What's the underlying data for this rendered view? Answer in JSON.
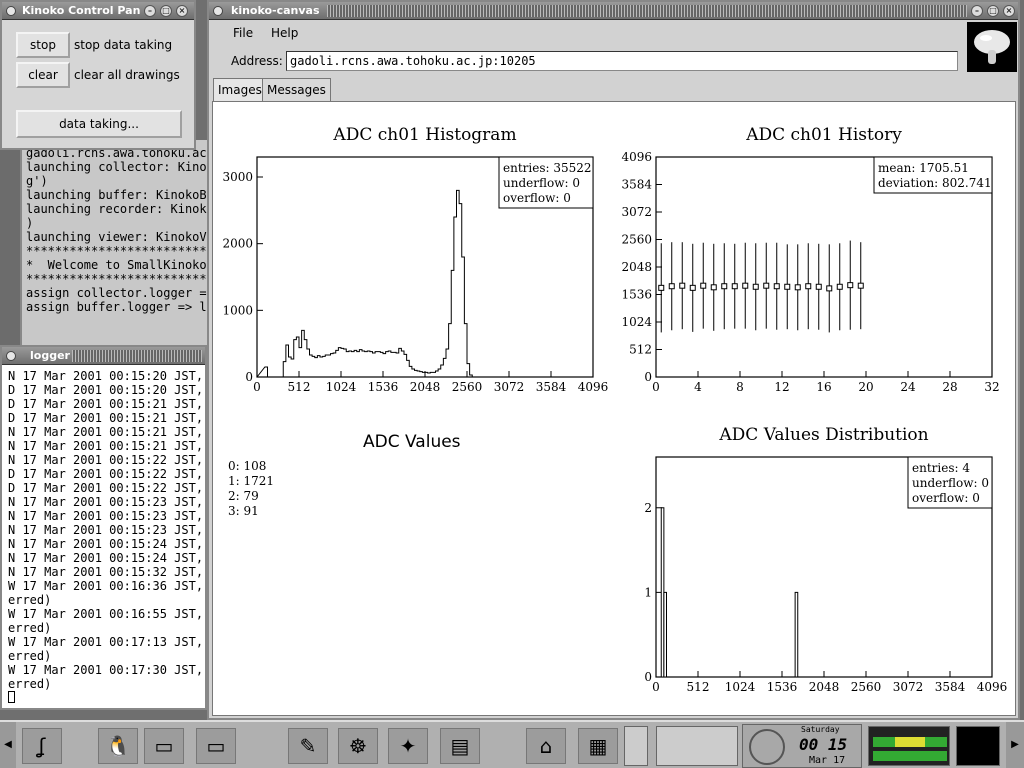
{
  "control_panel": {
    "title": "Kinoko Control Pan",
    "buttons": [
      {
        "label": "stop",
        "desc": "stop data taking"
      },
      {
        "label": "clear",
        "desc": "clear all drawings"
      }
    ],
    "data_taking_label": "data taking..."
  },
  "console": {
    "lines": [
      "gadoli.rcns.awa.tohoku.ac",
      "launching collector: Kinok",
      "g')",
      "launching buffer: KinokoBu",
      "launching recorder: Kinoko",
      ")",
      "launching viewer: KinokoVi",
      "",
      "**************************",
      "*  Welcome to SmallKinoko",
      "**************************",
      "",
      "assign collector.logger =>",
      "assign buffer.logger => lo"
    ]
  },
  "logger": {
    "title": "logger",
    "lines": [
      "N 17 Mar 2001 00:15:20 JST,",
      "D 17 Mar 2001 00:15:20 JST,",
      "D 17 Mar 2001 00:15:21 JST,",
      "D 17 Mar 2001 00:15:21 JST,",
      "N 17 Mar 2001 00:15:21 JST,",
      "N 17 Mar 2001 00:15:21 JST,",
      "N 17 Mar 2001 00:15:22 JST,",
      "D 17 Mar 2001 00:15:22 JST,",
      "D 17 Mar 2001 00:15:22 JST,",
      "N 17 Mar 2001 00:15:23 JST,",
      "N 17 Mar 2001 00:15:23 JST,",
      "N 17 Mar 2001 00:15:23 JST,",
      "N 17 Mar 2001 00:15:24 JST,",
      "N 17 Mar 2001 00:15:24 JST,",
      "N 17 Mar 2001 00:15:32 JST,",
      "W 17 Mar 2001 00:16:36 JST,",
      "erred)",
      "W 17 Mar 2001 00:16:55 JST,",
      "erred)",
      "W 17 Mar 2001 00:17:13 JST,",
      "erred)",
      "W 17 Mar 2001 00:17:30 JST,",
      "erred)"
    ]
  },
  "canvas": {
    "title": "kinoko-canvas",
    "menu": [
      "File",
      "Help"
    ],
    "address_label": "Address:",
    "address_value": "gadoli.rcns.awa.tohoku.ac.jp:10205",
    "tabs": [
      "Images",
      "Messages"
    ],
    "active_tab": "Images",
    "adc_values_title": "ADC Values",
    "adc_values": [
      "0: 108",
      "1: 1721",
      "2: 79",
      "3: 91"
    ]
  },
  "taskbar": {
    "clock_time": "00 15",
    "clock_day": "Saturday",
    "clock_date": "Mar 17"
  },
  "chart_data": [
    {
      "type": "histogram",
      "title": "ADC ch01 Histogram",
      "xlim": [
        0,
        4096
      ],
      "ylim": [
        0,
        3300
      ],
      "xticks": [
        0,
        512,
        1024,
        1536,
        2048,
        2560,
        3072,
        3584,
        4096
      ],
      "yticks": [
        0,
        1000,
        2000,
        3000
      ],
      "stats": {
        "entries": "35522",
        "underflow": "0",
        "overflow": "0"
      },
      "bin_width": 32,
      "bins": [
        [
          96,
          150
        ],
        [
          128,
          0
        ],
        [
          288,
          0
        ],
        [
          320,
          230
        ],
        [
          352,
          480
        ],
        [
          384,
          300
        ],
        [
          416,
          270
        ],
        [
          448,
          560
        ],
        [
          480,
          600
        ],
        [
          512,
          440
        ],
        [
          544,
          700
        ],
        [
          576,
          560
        ],
        [
          608,
          420
        ],
        [
          640,
          330
        ],
        [
          672,
          310
        ],
        [
          704,
          290
        ],
        [
          736,
          320
        ],
        [
          768,
          300
        ],
        [
          800,
          310
        ],
        [
          832,
          330
        ],
        [
          864,
          330
        ],
        [
          896,
          350
        ],
        [
          928,
          360
        ],
        [
          960,
          400
        ],
        [
          992,
          440
        ],
        [
          1024,
          430
        ],
        [
          1056,
          420
        ],
        [
          1088,
          380
        ],
        [
          1120,
          390
        ],
        [
          1152,
          380
        ],
        [
          1184,
          400
        ],
        [
          1216,
          380
        ],
        [
          1248,
          410
        ],
        [
          1280,
          390
        ],
        [
          1312,
          380
        ],
        [
          1344,
          390
        ],
        [
          1376,
          380
        ],
        [
          1408,
          360
        ],
        [
          1440,
          380
        ],
        [
          1472,
          380
        ],
        [
          1504,
          370
        ],
        [
          1536,
          350
        ],
        [
          1568,
          380
        ],
        [
          1600,
          390
        ],
        [
          1632,
          370
        ],
        [
          1664,
          370
        ],
        [
          1696,
          360
        ],
        [
          1728,
          430
        ],
        [
          1760,
          390
        ],
        [
          1792,
          340
        ],
        [
          1824,
          250
        ],
        [
          1856,
          160
        ],
        [
          1888,
          120
        ],
        [
          1920,
          100
        ],
        [
          1952,
          90
        ],
        [
          1984,
          80
        ],
        [
          2016,
          70
        ],
        [
          2048,
          70
        ],
        [
          2080,
          60
        ],
        [
          2112,
          70
        ],
        [
          2144,
          70
        ],
        [
          2176,
          90
        ],
        [
          2208,
          120
        ],
        [
          2240,
          180
        ],
        [
          2272,
          280
        ],
        [
          2304,
          420
        ],
        [
          2336,
          800
        ],
        [
          2368,
          1600
        ],
        [
          2400,
          2400
        ],
        [
          2432,
          2800
        ],
        [
          2464,
          2600
        ],
        [
          2496,
          1800
        ],
        [
          2528,
          800
        ],
        [
          2560,
          200
        ],
        [
          2592,
          30
        ],
        [
          2624,
          0
        ]
      ]
    },
    {
      "type": "error-bar",
      "title": "ADC ch01 History",
      "xlim": [
        0,
        32
      ],
      "ylim": [
        0,
        4096
      ],
      "xticks": [
        0,
        4,
        8,
        12,
        16,
        20,
        24,
        28,
        32
      ],
      "yticks": [
        0,
        512,
        1024,
        1536,
        2048,
        2560,
        3072,
        3584,
        4096
      ],
      "stats": {
        "mean": "1705.51",
        "deviation": "802.741"
      },
      "x": [
        0,
        1,
        2,
        3,
        4,
        5,
        6,
        7,
        8,
        9,
        10,
        11,
        12,
        13,
        14,
        15,
        16,
        17,
        18,
        19
      ],
      "mean": [
        1660,
        1690,
        1700,
        1660,
        1700,
        1670,
        1690,
        1690,
        1700,
        1680,
        1700,
        1690,
        1680,
        1670,
        1690,
        1680,
        1650,
        1680,
        1710,
        1700
      ],
      "err": [
        830,
        820,
        810,
        820,
        800,
        810,
        800,
        790,
        800,
        810,
        800,
        810,
        790,
        800,
        800,
        800,
        820,
        810,
        830,
        810
      ]
    },
    {
      "type": "histogram",
      "title": "ADC Values Distribution",
      "xlim": [
        0,
        4096
      ],
      "ylim": [
        0,
        2.6
      ],
      "xticks": [
        0,
        512,
        1024,
        1536,
        2048,
        2560,
        3072,
        3584,
        4096
      ],
      "yticks": [
        0,
        1,
        2
      ],
      "stats": {
        "entries": "4",
        "underflow": "0",
        "overflow": "0"
      },
      "bin_width": 32,
      "bins": [
        [
          64,
          2
        ],
        [
          96,
          1
        ],
        [
          1696,
          1
        ]
      ]
    }
  ]
}
